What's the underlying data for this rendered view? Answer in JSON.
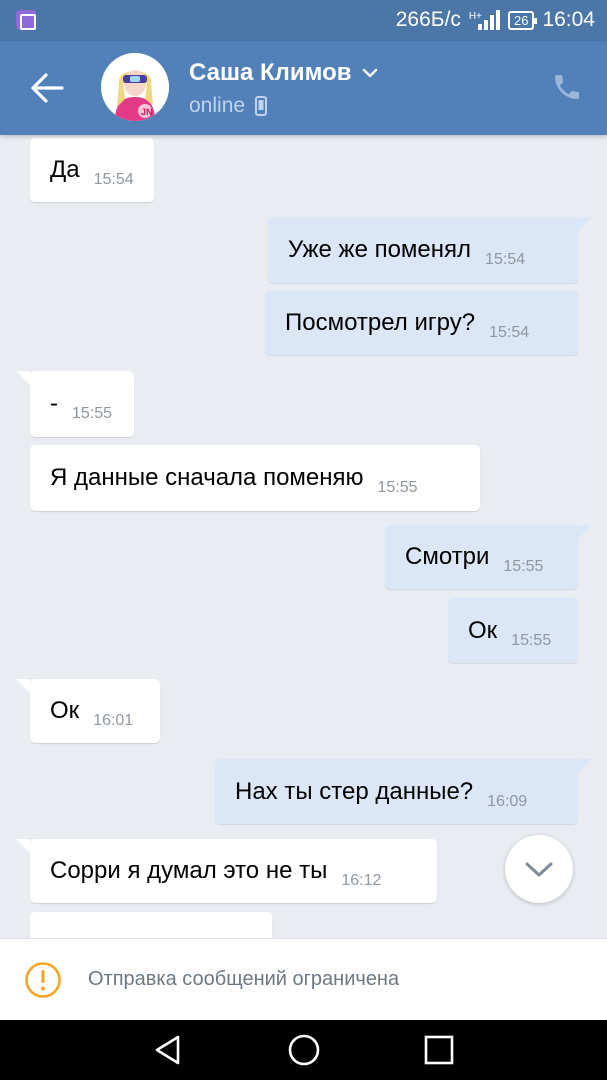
{
  "status_bar": {
    "network_speed": "266Б/с",
    "network_type": "H+",
    "battery": "26",
    "time": "16:04"
  },
  "header": {
    "contact_name": "Саша Климов",
    "contact_status": "online",
    "avatar_badge": "JN"
  },
  "messages": [
    {
      "dir": "in",
      "text": "Да",
      "time": "15:54"
    },
    {
      "dir": "out",
      "text": "Уже же поменял",
      "time": "15:54"
    },
    {
      "dir": "out",
      "text": "Посмотрел игру?",
      "time": "15:54"
    },
    {
      "dir": "in",
      "text": "-",
      "time": "15:55"
    },
    {
      "dir": "in",
      "text": "Я данные сначала поменяю",
      "time": "15:55"
    },
    {
      "dir": "out",
      "text": "Смотри",
      "time": "15:55"
    },
    {
      "dir": "out",
      "text": "Ок",
      "time": "15:55"
    },
    {
      "dir": "in",
      "text": "Ок",
      "time": "16:01"
    },
    {
      "dir": "out",
      "text": "Нах ты стер данные?",
      "time": "16:09"
    },
    {
      "dir": "in",
      "text": "Сорри я думал это не ты",
      "time": "16:12"
    },
    {
      "dir": "in",
      "text": "",
      "time": ""
    }
  ],
  "notice": {
    "text": "Отправка сообщений ограничена"
  },
  "colors": {
    "header": "#5181b8",
    "status_bar": "#4a76a8",
    "incoming_bubble": "#ffffff",
    "outgoing_bubble": "#dbe7f6",
    "warning": "#f5a623"
  }
}
